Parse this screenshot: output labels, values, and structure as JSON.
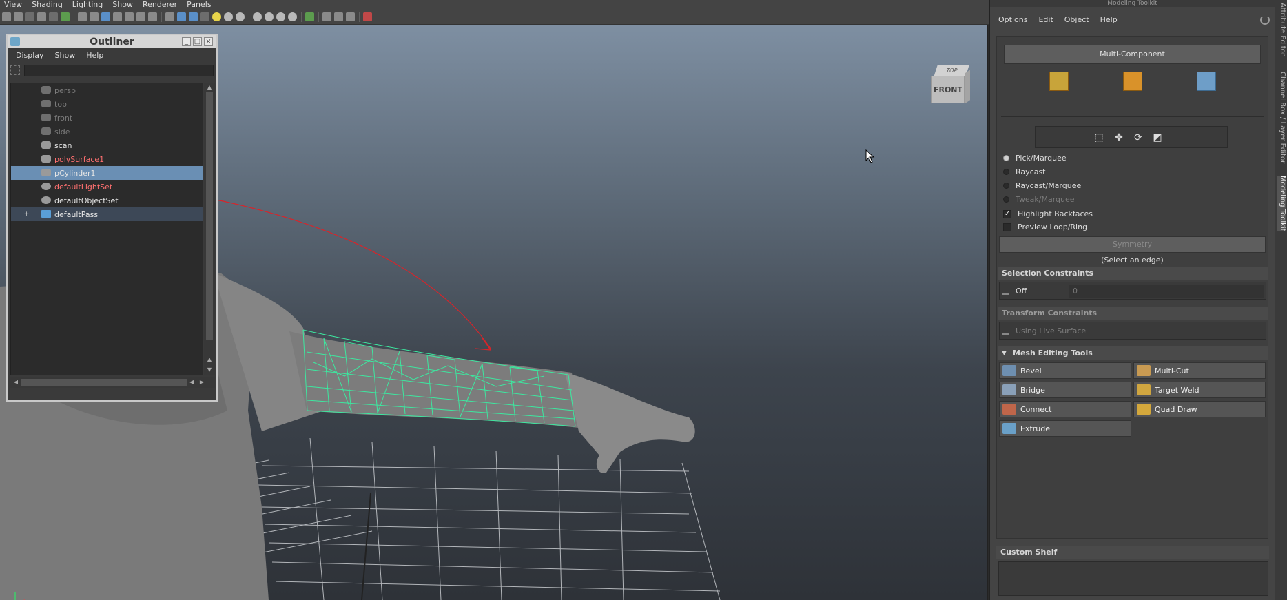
{
  "menubar": [
    "View",
    "Shading",
    "Lighting",
    "Show",
    "Renderer",
    "Panels"
  ],
  "outliner": {
    "title": "Outliner",
    "menu": [
      "Display",
      "Show",
      "Help"
    ],
    "search_value": "",
    "items": [
      {
        "label": "persp",
        "state": "dim"
      },
      {
        "label": "top",
        "state": "dim"
      },
      {
        "label": "front",
        "state": "dim"
      },
      {
        "label": "side",
        "state": "dim"
      },
      {
        "label": "scan",
        "state": "normal"
      },
      {
        "label": "polySurface1",
        "state": "red"
      },
      {
        "label": "pCylinder1",
        "state": "selected"
      },
      {
        "label": "defaultLightSet",
        "state": "red"
      },
      {
        "label": "defaultObjectSet",
        "state": "normal"
      },
      {
        "label": "defaultPass",
        "state": "pass"
      }
    ],
    "expand_symbol": "+"
  },
  "viewcube": {
    "top": "TOP",
    "front": "FRONT"
  },
  "toolkit": {
    "title": "Modeling Toolkit",
    "menu": [
      "Options",
      "Edit",
      "Object",
      "Help"
    ],
    "multi_component": "Multi-Component",
    "selection_modes": [
      {
        "label": "Pick/Marquee",
        "selected": true,
        "disabled": false
      },
      {
        "label": "Raycast",
        "selected": false,
        "disabled": false
      },
      {
        "label": "Raycast/Marquee",
        "selected": false,
        "disabled": false
      },
      {
        "label": "Tweak/Marquee",
        "selected": false,
        "disabled": true
      }
    ],
    "checks": [
      {
        "label": "Highlight Backfaces",
        "checked": true,
        "mark": "✓"
      },
      {
        "label": "Preview Loop/Ring",
        "checked": false,
        "mark": ""
      }
    ],
    "symmetry": "Symmetry",
    "symmetry_hint": "(Select an edge)",
    "selection_constraints": {
      "title": "Selection Constraints",
      "value": "Off",
      "field": "0"
    },
    "transform_constraints": {
      "title": "Transform Constraints",
      "value": "Using Live Surface"
    },
    "mesh_editing": {
      "title": "Mesh Editing Tools",
      "tools": [
        {
          "label": "Bevel",
          "color": "#6e8fb0"
        },
        {
          "label": "Multi-Cut",
          "color": "#c89a52"
        },
        {
          "label": "Bridge",
          "color": "#8aa0b8"
        },
        {
          "label": "Target Weld",
          "color": "#d0a640"
        },
        {
          "label": "Connect",
          "color": "#c0664a"
        },
        {
          "label": "Quad Draw",
          "color": "#d4a83c"
        },
        {
          "label": "Extrude",
          "color": "#6aa0c8"
        }
      ]
    },
    "custom_shelf": "Custom Shelf"
  },
  "side_tabs": [
    "Attribute Editor",
    "Channel Box / Layer Editor",
    "Modeling Toolkit"
  ],
  "colors": {
    "accent": "#6a8fb4",
    "wire": "#3de8a0",
    "annotation": "#d8242a"
  }
}
